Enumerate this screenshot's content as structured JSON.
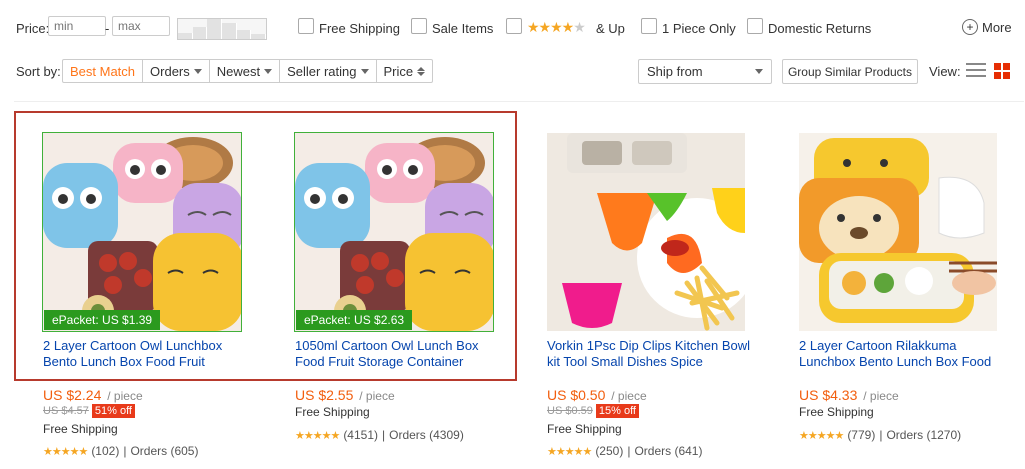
{
  "filters": {
    "price_label": "Price:",
    "min_placeholder": "min",
    "max_placeholder": "max",
    "dash": "-",
    "free_shipping": "Free Shipping",
    "sale_items": "Sale Items",
    "stars_up": "& Up",
    "one_piece_only": "1 Piece Only",
    "domestic_returns": "Domestic Returns",
    "more": "More"
  },
  "sort": {
    "label": "Sort by:",
    "items": [
      "Best Match",
      "Orders",
      "Newest",
      "Seller rating",
      "Price"
    ],
    "ship_from": "Ship from",
    "group_similar": "Group Similar Products",
    "view_label": "View:"
  },
  "colors": {
    "accent": "#ff7519",
    "price": "#f25e0e",
    "link": "#0645ad",
    "epacket": "#2b9a1e",
    "highlight": "#b73a2d"
  },
  "products": [
    {
      "epacket": "ePacket: US $1.39",
      "title": "2 Layer Cartoon Owl Lunchbox Bento Lunch Box Food Fruit",
      "price": "US $2.24",
      "unit": "/ piece",
      "old_price": "US $4.57",
      "discount": "51% off",
      "shipping": "Free Shipping",
      "reviews": "(102)",
      "sep": "|",
      "orders": "Orders (605)"
    },
    {
      "epacket": "ePacket: US $2.63",
      "title": "1050ml Cartoon Owl Lunch Box Food Fruit Storage Container",
      "price": "US $2.55",
      "unit": "/ piece",
      "shipping": "Free Shipping",
      "reviews": "(4151)",
      "sep": "|",
      "orders": "Orders (4309)"
    },
    {
      "title": "Vorkin 1Psc Dip Clips Kitchen Bowl kit Tool Small Dishes Spice",
      "price": "US $0.50",
      "unit": "/ piece",
      "old_price": "US $0.59",
      "discount": "15% off",
      "shipping": "Free Shipping",
      "reviews": "(250)",
      "sep": "|",
      "orders": "Orders (641)"
    },
    {
      "title": "2 Layer Cartoon Rilakkuma Lunchbox Bento Lunch Box Food",
      "price": "US $4.33",
      "unit": "/ piece",
      "shipping": "Free Shipping",
      "reviews": "(779)",
      "sep": "|",
      "orders": "Orders (1270)"
    }
  ]
}
